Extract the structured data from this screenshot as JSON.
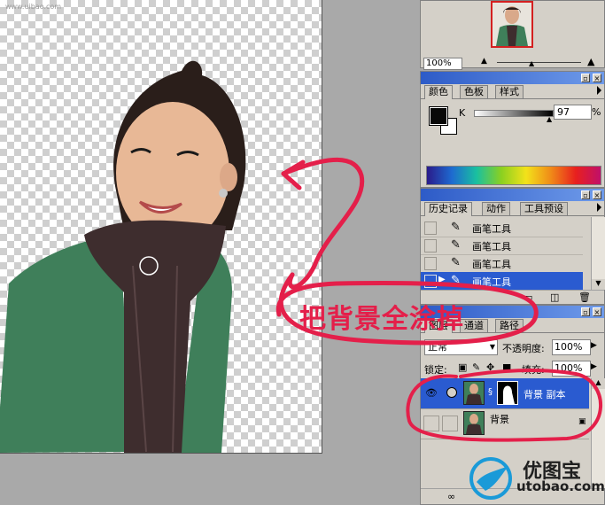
{
  "watermark_top": "www.uibao.com",
  "navigator": {
    "zoom": "100%"
  },
  "color_panel": {
    "tabs": [
      "颜色",
      "色板",
      "样式"
    ],
    "channel_label": "K",
    "value": "97",
    "unit": "%"
  },
  "history_panel": {
    "tabs": [
      "历史记录",
      "动作",
      "工具预设"
    ],
    "items": [
      "画笔工具",
      "画笔工具",
      "画笔工具",
      "画笔工具"
    ],
    "selected_index": 3
  },
  "layers_panel": {
    "tabs": [
      "图层",
      "通道",
      "路径"
    ],
    "blend_mode": "正常",
    "opacity_label": "不透明度:",
    "opacity_value": "100%",
    "lock_label": "锁定:",
    "fill_label": "填充:",
    "fill_value": "100%",
    "layers": [
      {
        "name": "背景 副本",
        "selected": true
      },
      {
        "name": "背景",
        "selected": false
      }
    ]
  },
  "annotation": {
    "text": "把背景全涂掉"
  },
  "watermark": {
    "cn": "优图宝",
    "en": "utobao.com"
  },
  "colors": {
    "annotation": "#e41f4a",
    "title_bar": "#2d5bc7",
    "selection": "#2a5bd0"
  }
}
